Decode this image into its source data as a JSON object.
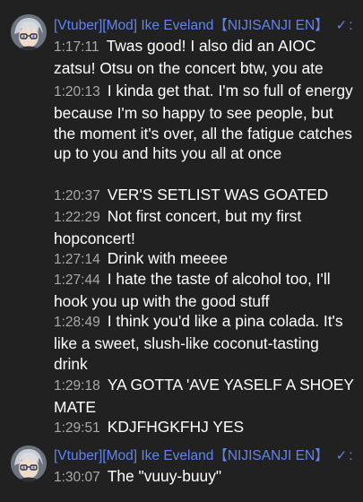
{
  "colors": {
    "background": "#212121",
    "author": "#5e84f1",
    "timestamp": "#a9a9a9",
    "message": "#ffffff"
  },
  "groups": [
    {
      "author": "[Vtuber][Mod] Ike Eveland【NIJISANJI EN】",
      "badge_icon": "verified-check-icon",
      "messages": [
        {
          "time": "1:17:11",
          "text": "Twas good! I also did an AIOC zatsu! Otsu on the concert btw, you ate"
        },
        {
          "time": "1:20:13",
          "text": "I kinda get that. I'm so full of energy because I'm so happy to see people, but the moment it's over, all the fatigue catches up to you and hits you all at once"
        },
        {
          "time": "1:20:37",
          "text": "VER'S SETLIST WAS GOATED"
        },
        {
          "time": "1:22:29",
          "text": "Not first concert, but my first hopconcert!"
        },
        {
          "time": "1:27:14",
          "text": "Drink with meeee"
        },
        {
          "time": "1:27:44",
          "text": "I hate the taste of alcohol too, I'll hook you up with the good stuff"
        },
        {
          "time": "1:28:49",
          "text": "I think you'd like a pina colada. It's like a sweet, slush-like coconut-tasting drink"
        },
        {
          "time": "1:29:18",
          "text": "YA GOTTA 'AVE YASELF A SHOEY MATE"
        },
        {
          "time": "1:29:51",
          "text": "KDJFHGKFHJ YES"
        }
      ]
    },
    {
      "author": "[Vtuber][Mod] Ike Eveland【NIJISANJI EN】",
      "badge_icon": "verified-check-icon",
      "messages": [
        {
          "time": "1:30:07",
          "text": "The \"vuuy-buuy\""
        }
      ]
    }
  ]
}
